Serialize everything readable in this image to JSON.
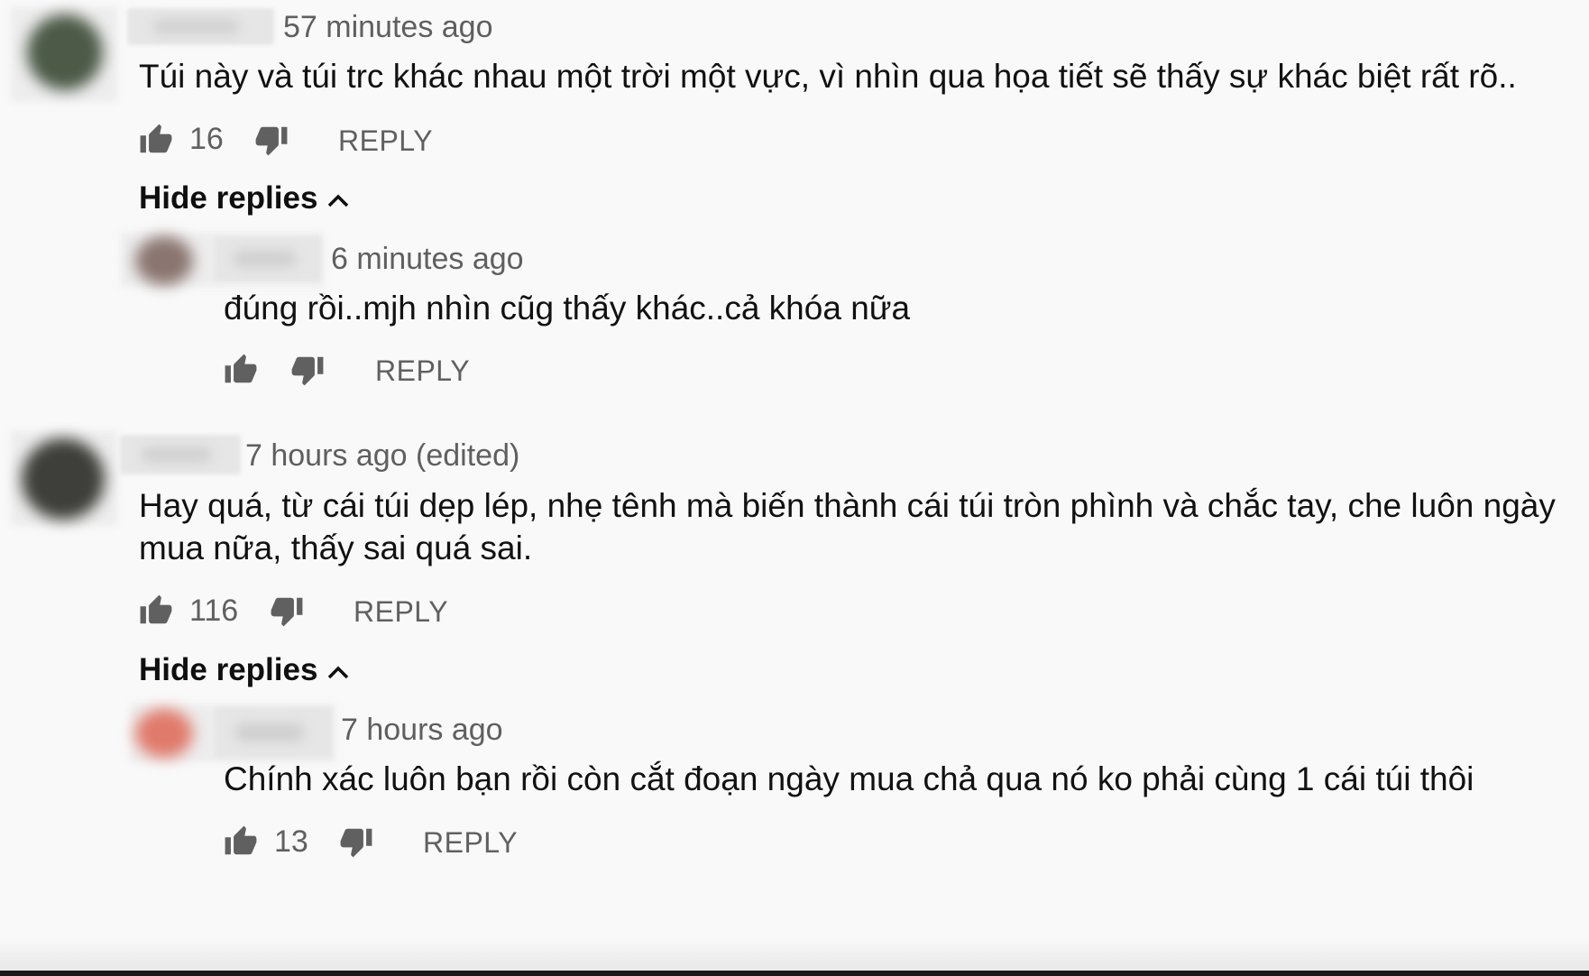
{
  "comments": [
    {
      "timestamp": "57 minutes ago",
      "text": "Túi này và túi trc khác nhau một trời một vực, vì nhìn qua họa tiết sẽ thấy sự khác biệt rất rõ..",
      "likes": "16",
      "reply_label": "REPLY",
      "hide_replies_label": "Hide replies",
      "avatar_color": "#4d5a48",
      "replies": [
        {
          "timestamp": "6 minutes ago",
          "text": "đúng rồi..mjh nhìn cũg thấy khác..cả khóa nữa",
          "likes": "",
          "reply_label": "REPLY",
          "avatar_color": "#8a7570"
        }
      ]
    },
    {
      "timestamp": "7 hours ago (edited)",
      "text_lines": [
        "Hay quá, từ cái túi dẹp lép, nhẹ tênh mà biến thành cái túi tròn phình và chắc tay, che luôn ngày",
        "mua nữa, thấy sai quá sai."
      ],
      "likes": "116",
      "reply_label": "REPLY",
      "hide_replies_label": "Hide replies",
      "avatar_color": "#3e3e3a",
      "replies": [
        {
          "timestamp": "7 hours ago",
          "text": "Chính xác luôn bạn rồi còn cắt đoạn ngày mua chả qua nó ko phải cùng 1 cái túi thôi",
          "likes": "13",
          "reply_label": "REPLY",
          "avatar_color": "#e07a6a"
        }
      ]
    }
  ],
  "icons": {
    "like": "thumbs-up-icon",
    "dislike": "thumbs-down-icon",
    "hide": "chevron-up-icon"
  },
  "colors": {
    "background": "#f9f9f9",
    "text": "#0f0f0f",
    "secondary_text": "#606060"
  }
}
